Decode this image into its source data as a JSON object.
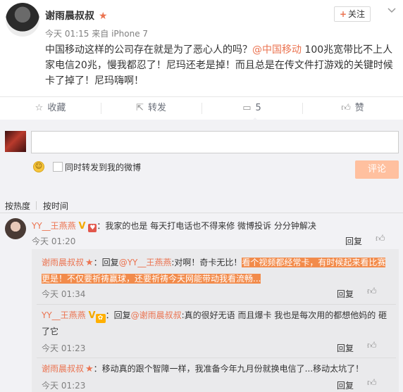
{
  "post": {
    "author": "谢雨晨叔叔",
    "time": "今天 01:15",
    "source_prefix": "来自",
    "source": "iPhone 7",
    "follow_label": "关注",
    "text_part1": "中国移动这样的公司存在就是为了恶心人的吗？",
    "mention": "@中国移动",
    "text_part2": " 100兆宽带比不上人家电信20兆，慢我都忍了！尼玛还老是掉！而且总是在传文件打游戏的关键时候卡了掉了！尼玛嗨啊！"
  },
  "actions": {
    "collect": "收藏",
    "forward": "转发",
    "comment_count": "5",
    "like": "赞"
  },
  "composer": {
    "input_value": "",
    "also_forward_label": "同时转发到我的微博",
    "submit_label": "评论"
  },
  "sort": {
    "by_hot": "按热度",
    "by_time": "按时间"
  },
  "comments": [
    {
      "user": "YY__王燕燕",
      "text": "：我家的也是 每天打电话也不得来修 微博投诉 分分钟解决",
      "time": "今天 01:20",
      "reply_label": "回复"
    }
  ],
  "replies": [
    {
      "user": "谢雨晨叔叔",
      "prefix": "：回复",
      "mention": "@YY__王燕燕",
      "text_a": ":对啊！奇卡无比！",
      "hl_line1": "看个视频都经常卡，有时候起来看比赛",
      "hl_line2": "更是！不仅要祈祷赢球，还要祈祷今天网能带动我看流畅...",
      "time": "今天 01:34",
      "reply_label": "回复"
    },
    {
      "user": "YY__王燕燕",
      "prefix": "：回复",
      "mention": "@谢雨晨叔叔",
      "text_line1": ":真的很好无语 而且爆卡 我也是每次用的都想他妈的 砸",
      "text_line2": "了它",
      "time": "今天 01:23",
      "reply_label": "回复"
    },
    {
      "user": "谢雨晨叔叔",
      "text": "：移动真的跟个智障一样，我准备今年九月份就换电信了...移动太坑了！",
      "time": "今天 01:23",
      "reply_label": "回复"
    }
  ],
  "colors": {
    "accent": "#eb7350",
    "highlight": "#f28b4b",
    "comment_bg": "#f2f2f5",
    "submit_bg": "#ffc09f"
  }
}
